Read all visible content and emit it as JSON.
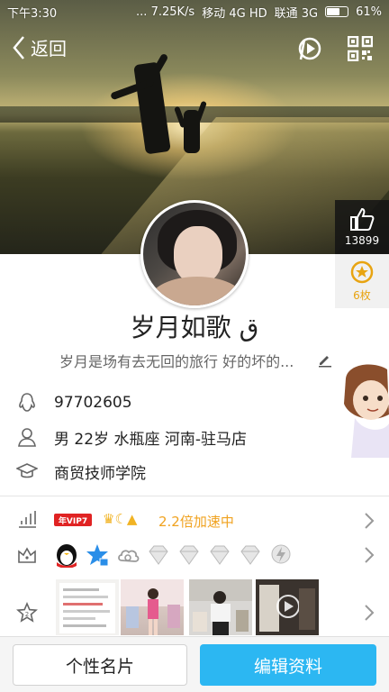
{
  "status_bar": {
    "time": "下午3:30",
    "network_speed": "... 7.25K/s",
    "carrier1": "移动 4G HD",
    "carrier2": "联通 3G",
    "battery": "61%"
  },
  "topbar": {
    "back_label": "返回",
    "music_icon": "music-disc-icon",
    "qr_icon": "qr-code-icon"
  },
  "like": {
    "count": "13899"
  },
  "medal": {
    "count": "6枚"
  },
  "profile": {
    "name": "岁月如歌 ق",
    "signature": "岁月是场有去无回的旅行 好的坏的..."
  },
  "info": {
    "qq_number": "97702605",
    "details": "男  22岁  水瓶座  河南-驻马店",
    "school": "商贸技师学院"
  },
  "vip": {
    "badge": "年VIP7",
    "crowns": "♛☾▲",
    "speed": "2.2倍加速中"
  },
  "bottom": {
    "card_button": "个性名片",
    "edit_button": "编辑资料"
  },
  "colors": {
    "accent_blue": "#2cb7f2",
    "vip_red": "#e02323",
    "speed_orange": "#f0a21f"
  }
}
